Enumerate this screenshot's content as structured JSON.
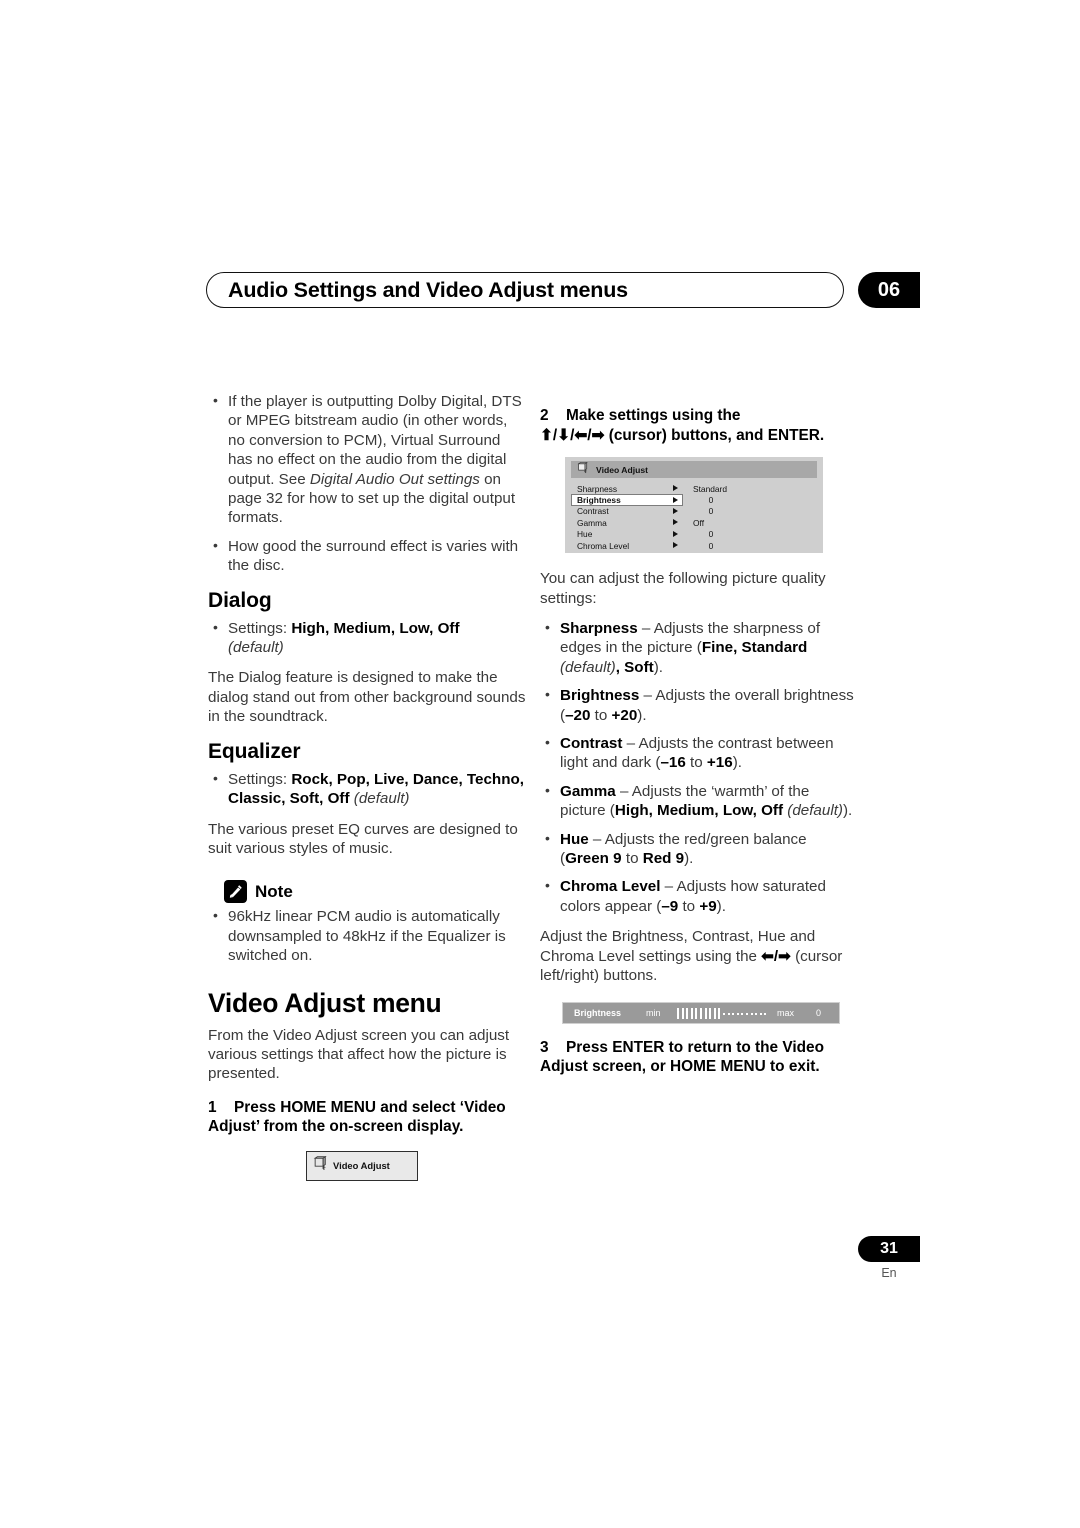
{
  "header": {
    "chapter_title": "Audio Settings and Video Adjust menus",
    "chapter_number": "06"
  },
  "left_column": {
    "intro_bullets": [
      "If the player is outputting Dolby Digital, DTS or MPEG bitstream audio (in other words, no conversion to PCM), Virtual Surround has no effect on the audio from the digital output. See Digital Audio Out settings on page 32 for how to set up the digital output formats.",
      "How good the surround effect is varies with the disc."
    ],
    "dialog": {
      "heading": "Dialog",
      "settings_prefix": "Settings: ",
      "settings_values": "High, Medium, Low, Off",
      "settings_default": "(default)",
      "paragraph": "The Dialog feature is designed to make the dialog stand out from other background sounds in the soundtrack."
    },
    "equalizer": {
      "heading": "Equalizer",
      "settings_prefix": "Settings: ",
      "settings_values": "Rock, Pop, Live, Dance, Techno, Classic, Soft, Off",
      "settings_default": "(default)",
      "paragraph": "The various preset EQ curves are designed to suit various styles of music."
    },
    "note": {
      "label": "Note",
      "icon": "pencil-icon",
      "bullet": "96kHz linear PCM audio is automatically downsampled to 48kHz if the Equalizer is switched on."
    },
    "video_adjust_menu": {
      "heading": "Video Adjust menu",
      "paragraph": "From the Video Adjust screen you can adjust various settings that affect how the picture is presented."
    },
    "step1": {
      "number": "1",
      "text": "Press HOME MENU and select ‘Video Adjust’ from the on-screen display."
    },
    "osd_button": {
      "icon": "video-adjust-icon",
      "label": "Video Adjust"
    }
  },
  "right_column": {
    "step2": {
      "number": "2",
      "line1": "Make settings using the",
      "arrows": "⬆/⬇/⬅/➡",
      "line2": "(cursor) buttons, and ENTER."
    },
    "osd_panel": {
      "icon": "video-adjust-icon",
      "title": "Video Adjust",
      "rows": [
        {
          "label": "Sharpness",
          "value": "Standard",
          "selected": false
        },
        {
          "label": "Brightness",
          "value": "0",
          "selected": true
        },
        {
          "label": "Contrast",
          "value": "0",
          "selected": false
        },
        {
          "label": "Gamma",
          "value": "Off",
          "selected": false
        },
        {
          "label": "Hue",
          "value": "0",
          "selected": false
        },
        {
          "label": "Chroma Level",
          "value": "0",
          "selected": false
        }
      ]
    },
    "intro": "You can adjust the following picture quality settings:",
    "settings_bullets": [
      {
        "name": "Sharpness",
        "dash": " – ",
        "desc_before": "Adjusts the sharpness of edges in the picture (",
        "bold_values": "Fine, Standard",
        "italic_default": " (default)",
        "bold_tail": ", Soft",
        "desc_after": ")."
      },
      {
        "name": "Brightness",
        "dash": " – ",
        "desc_before": "Adjusts the overall brightness (",
        "bold_values": "–20",
        "mid": " to ",
        "bold_tail": "+20",
        "desc_after": ")."
      },
      {
        "name": "Contrast",
        "dash": " – ",
        "desc_before": "Adjusts the contrast between light and dark (",
        "bold_values": "–16",
        "mid": " to ",
        "bold_tail": "+16",
        "desc_after": ")."
      },
      {
        "name": "Gamma",
        "dash": " – ",
        "desc_before": "Adjusts the ‘warmth’ of the picture (",
        "bold_values": "High, Medium, Low, Off",
        "italic_default": " (default)",
        "desc_after": ")."
      },
      {
        "name": "Hue",
        "dash": " – ",
        "desc_before": "Adjusts the red/green balance (",
        "bold_values": "Green 9",
        "mid": " to ",
        "bold_tail": "Red 9",
        "desc_after": ")."
      },
      {
        "name": "Chroma Level",
        "dash": " – ",
        "desc_before": "Adjusts how saturated colors appear (",
        "bold_values": "–9",
        "mid": " to ",
        "bold_tail": "+9",
        "desc_after": ")."
      }
    ],
    "adjust_paragraph_before": "Adjust the Brightness, Contrast, Hue and Chroma Level settings using the ",
    "adjust_paragraph_arrows": "⬅/➡",
    "adjust_paragraph_after": " (cursor left/right) buttons.",
    "osd_bar": {
      "label": "Brightness",
      "min": "min",
      "max": "max",
      "value": "0",
      "filled_ticks": 10,
      "empty_ticks": 10
    },
    "step3": {
      "number": "3",
      "text": "Press ENTER to return to the Video Adjust screen, or HOME MENU to exit."
    }
  },
  "footer": {
    "page_number": "31",
    "language": "En"
  }
}
